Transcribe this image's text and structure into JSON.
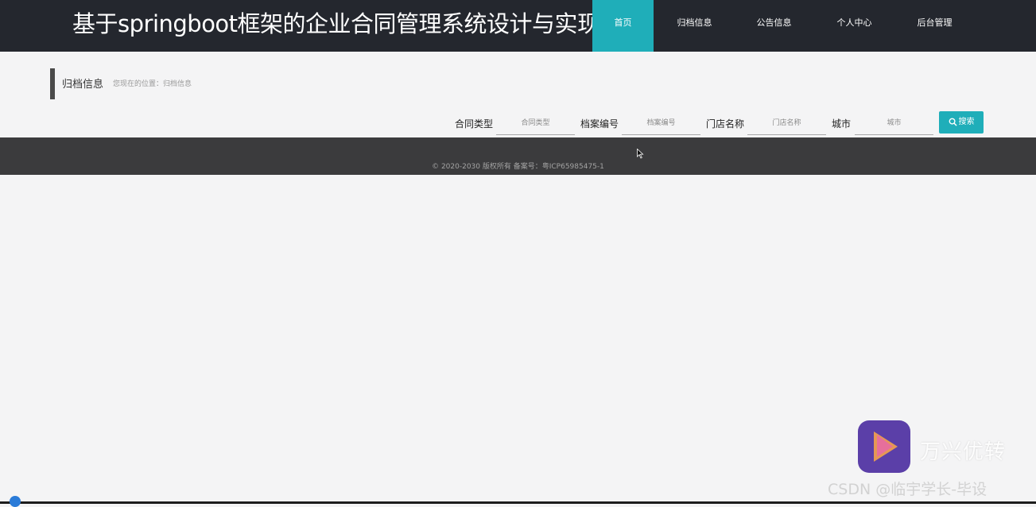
{
  "header": {
    "site_title": "基于springboot框架的企业合同管理系统设计与实现",
    "nav": [
      {
        "label": "首页",
        "active": true
      },
      {
        "label": "归档信息",
        "active": false
      },
      {
        "label": "公告信息",
        "active": false
      },
      {
        "label": "个人中心",
        "active": false
      },
      {
        "label": "后台管理",
        "active": false
      }
    ]
  },
  "breadcrumb": {
    "title": "归档信息",
    "location": "您现在的位置：归档信息"
  },
  "search": {
    "fields": [
      {
        "label": "合同类型",
        "placeholder": "合同类型"
      },
      {
        "label": "档案编号",
        "placeholder": "档案编号"
      },
      {
        "label": "门店名称",
        "placeholder": "门店名称"
      },
      {
        "label": "城市",
        "placeholder": "城市"
      }
    ],
    "button_label": "搜索"
  },
  "footer": {
    "copyright": "© 2020-2030 版权所有 备案号：粤ICP65985475-1"
  },
  "watermark": {
    "app_name": "万兴优转",
    "source": "CSDN @临宇学长-毕设"
  },
  "colors": {
    "accent": "#1faeb9",
    "header_bg": "#24272e",
    "footer_bg": "#3b3b3d"
  }
}
